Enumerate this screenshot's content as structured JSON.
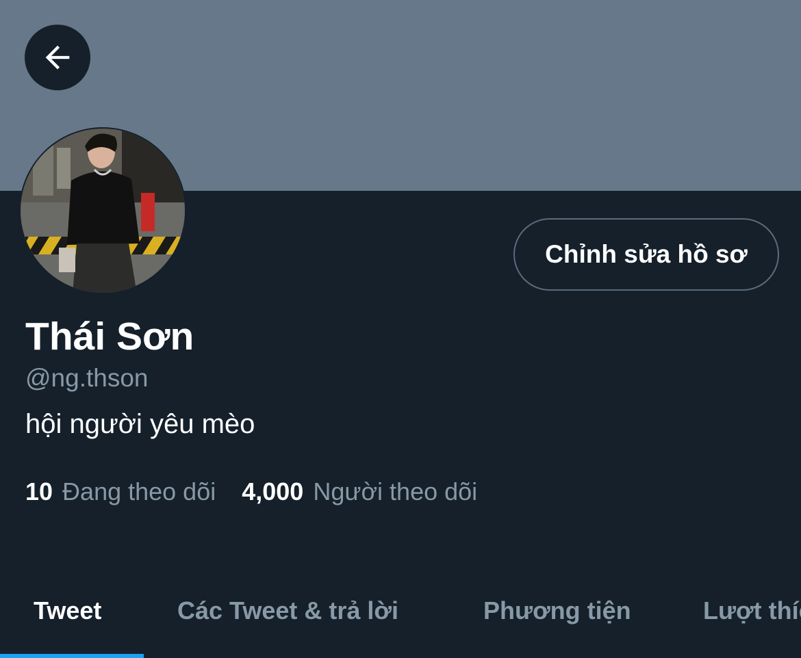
{
  "header": {
    "back_icon": "arrow-left-icon",
    "banner_color": "#66788a"
  },
  "profile": {
    "avatar_icon": "avatar-photo",
    "edit_button_label": "Chỉnh sửa hồ sơ",
    "display_name": "Thái Sơn",
    "handle": "@ng.thson",
    "bio": "hội người yêu mèo"
  },
  "stats": {
    "following_count": "10",
    "following_label": "Đang theo dõi",
    "followers_count": "4,000",
    "followers_label": "Người theo dõi"
  },
  "tabs": [
    {
      "label": "Tweet",
      "active": true
    },
    {
      "label": "Các Tweet & trả lời",
      "active": false
    },
    {
      "label": "Phương tiện",
      "active": false
    },
    {
      "label": "Lượt thích",
      "active": false
    }
  ],
  "colors": {
    "background": "#15202b",
    "accent": "#1da1f2",
    "muted_text": "#8899a6"
  }
}
